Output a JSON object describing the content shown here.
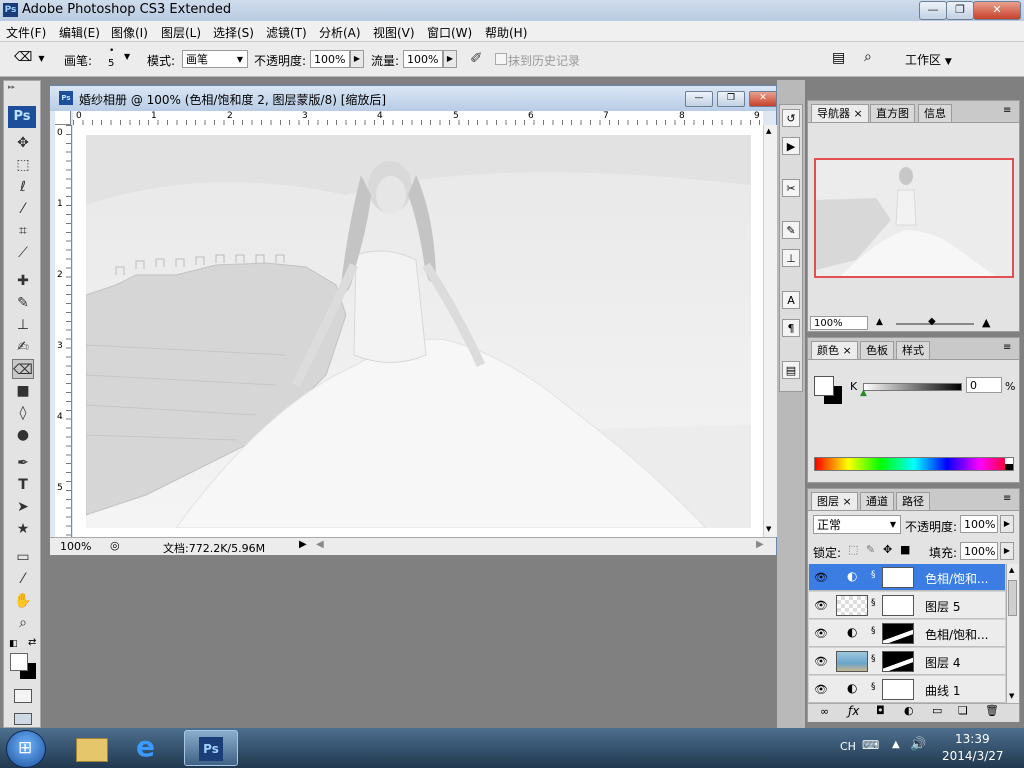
{
  "app": {
    "title": "Adobe Photoshop CS3 Extended",
    "ps_badge": "Ps"
  },
  "window_buttons": {
    "min": "—",
    "max": "❐",
    "close": "✕"
  },
  "menu": [
    "文件(F)",
    "编辑(E)",
    "图像(I)",
    "图层(L)",
    "选择(S)",
    "滤镜(T)",
    "分析(A)",
    "视图(V)",
    "窗口(W)",
    "帮助(H)"
  ],
  "options": {
    "brush_label": "画笔:",
    "brush_size": "5",
    "mode_label": "模式:",
    "mode_value": "画笔",
    "opacity_label": "不透明度:",
    "opacity_value": "100%",
    "flow_label": "流量:",
    "flow_value": "100%",
    "erase_history_label": "抹到历史记录",
    "workspace_label": "工作区"
  },
  "document": {
    "title": "婚纱相册 @ 100% (色相/饱和度 2, 图层蒙版/8) [缩放后]",
    "ruler_top": [
      "0",
      "1",
      "2",
      "3",
      "4",
      "5",
      "6",
      "7",
      "8",
      "9"
    ],
    "ruler_left": [
      "0",
      "1",
      "2",
      "3",
      "4",
      "5"
    ],
    "zoom": "100%",
    "doc_size": "文档:772.2K/5.96M"
  },
  "navigator": {
    "tabs": [
      "导航器",
      "直方图",
      "信息"
    ],
    "zoom": "100%"
  },
  "color_panel": {
    "tabs": [
      "颜色",
      "色板",
      "样式"
    ],
    "channel": "K",
    "value": "0",
    "unit": "%"
  },
  "layers_panel": {
    "tabs": [
      "图层",
      "通道",
      "路径"
    ],
    "blend_mode": "正常",
    "opacity_label": "不透明度:",
    "opacity_value": "100%",
    "lock_label": "锁定:",
    "fill_label": "填充:",
    "fill_value": "100%",
    "layers": [
      {
        "name": "色相/饱和...",
        "selected": true
      },
      {
        "name": "图层 5",
        "selected": false
      },
      {
        "name": "色相/饱和...",
        "selected": false
      },
      {
        "name": "图层 4",
        "selected": false
      },
      {
        "name": "曲线 1",
        "selected": false
      }
    ]
  },
  "taskbar": {
    "lang": "CH",
    "time": "13:39",
    "date": "2014/3/27",
    "ps_label": "Ps"
  },
  "colors": {
    "selection_blue": "#3b7de3",
    "title_gradient_top": "#cfdcec",
    "nav_frame": "#e05050"
  }
}
